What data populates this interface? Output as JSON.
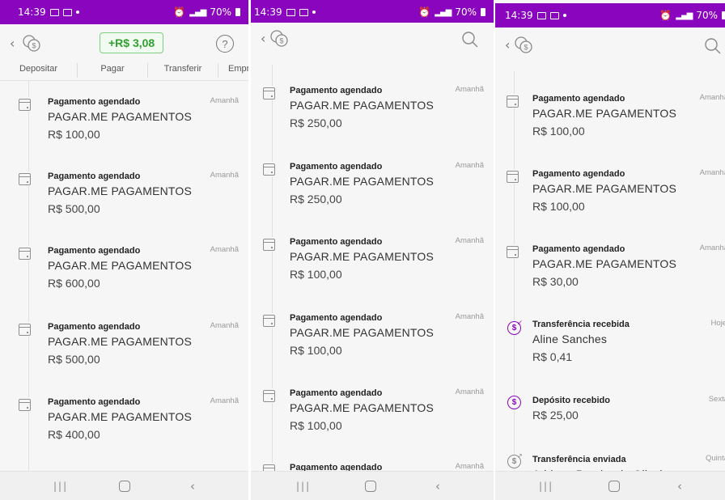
{
  "statusbar": {
    "time": "14:39",
    "battery": "70%"
  },
  "icons": {
    "back": "chevron-left-icon",
    "coin": "coins-icon",
    "help": "question-mark-icon",
    "search": "search-icon",
    "calendar": "calendar-icon",
    "transfer_in": "money-in-icon",
    "transfer_out": "money-out-icon"
  },
  "colors": {
    "brand": "#8a05be",
    "positive": "#2fa12f"
  },
  "screen1": {
    "balance_chip": "+R$ 3,08",
    "tabs": [
      "Depositar",
      "Pagar",
      "Transferir",
      "Empr"
    ],
    "items": [
      {
        "kind": "Pagamento agendado",
        "when": "Amanhã",
        "name": "PAGAR.ME PAGAMENTOS",
        "amount": "R$ 100,00"
      },
      {
        "kind": "Pagamento agendado",
        "when": "Amanhã",
        "name": "PAGAR.ME PAGAMENTOS",
        "amount": "R$ 500,00"
      },
      {
        "kind": "Pagamento agendado",
        "when": "Amanhã",
        "name": "PAGAR.ME PAGAMENTOS",
        "amount": "R$ 600,00"
      },
      {
        "kind": "Pagamento agendado",
        "when": "Amanhã",
        "name": "PAGAR.ME PAGAMENTOS",
        "amount": "R$ 500,00"
      },
      {
        "kind": "Pagamento agendado",
        "when": "Amanhã",
        "name": "PAGAR.ME PAGAMENTOS",
        "amount": "R$ 400,00"
      }
    ]
  },
  "screen2": {
    "items": [
      {
        "kind": "Pagamento agendado",
        "when": "Amanhã",
        "name": "PAGAR.ME PAGAMENTOS",
        "amount": "R$ 250,00"
      },
      {
        "kind": "Pagamento agendado",
        "when": "Amanhã",
        "name": "PAGAR.ME PAGAMENTOS",
        "amount": "R$ 250,00"
      },
      {
        "kind": "Pagamento agendado",
        "when": "Amanhã",
        "name": "PAGAR.ME PAGAMENTOS",
        "amount": "R$ 100,00"
      },
      {
        "kind": "Pagamento agendado",
        "when": "Amanhã",
        "name": "PAGAR.ME PAGAMENTOS",
        "amount": "R$ 100,00"
      },
      {
        "kind": "Pagamento agendado",
        "when": "Amanhã",
        "name": "PAGAR.ME PAGAMENTOS",
        "amount": "R$ 100,00"
      },
      {
        "kind": "Pagamento agendado",
        "when": "Amanhã",
        "name": "",
        "amount": ""
      }
    ]
  },
  "screen3": {
    "items": [
      {
        "kind": "Pagamento agendado",
        "when": "Amanhã",
        "name": "PAGAR.ME PAGAMENTOS",
        "amount": "R$ 100,00"
      },
      {
        "kind": "Pagamento agendado",
        "when": "Amanhã",
        "name": "PAGAR.ME PAGAMENTOS",
        "amount": "R$ 100,00"
      },
      {
        "kind": "Pagamento agendado",
        "when": "Amanhã",
        "name": "PAGAR.ME PAGAMENTOS",
        "amount": "R$ 30,00"
      },
      {
        "kind": "Transferência recebida",
        "when": "Hoje",
        "name": "Aline Sanches",
        "amount": "R$ 0,41"
      },
      {
        "kind": "Depósito recebido",
        "when": "Sexta",
        "name": "",
        "amount": "R$ 25,00"
      },
      {
        "kind": "Transferência enviada",
        "when": "Quinta",
        "name": "Adriana Pereira de Oliveira",
        "amount": ""
      }
    ]
  }
}
